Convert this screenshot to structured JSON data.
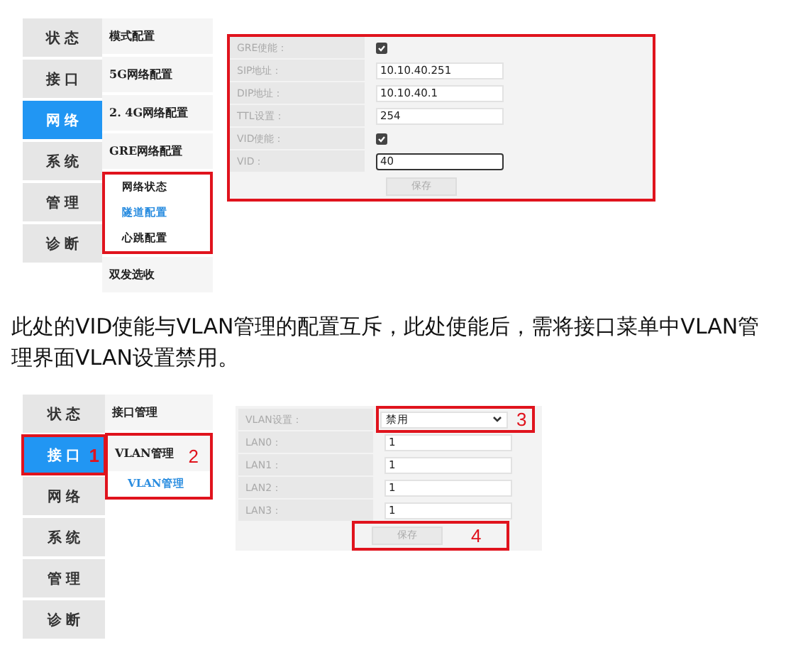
{
  "screens": [
    {
      "nav": [
        {
          "label": "状 态",
          "selected": false,
          "highlighted": false
        },
        {
          "label": "接 口",
          "selected": false,
          "highlighted": false
        },
        {
          "label": "网 络",
          "selected": true,
          "highlighted": false
        },
        {
          "label": "系 统",
          "selected": false,
          "highlighted": false
        },
        {
          "label": "管 理",
          "selected": false,
          "highlighted": false
        },
        {
          "label": "诊 断",
          "selected": false,
          "highlighted": false
        }
      ],
      "menu": [
        {
          "label": "模式配置",
          "highlighted": false
        },
        {
          "label": "5G网络配置",
          "highlighted": false
        },
        {
          "label": "2. 4G网络配置",
          "highlighted": false
        },
        {
          "label": "GRE网络配置",
          "highlighted": true,
          "frame_includes_item": false,
          "children": [
            {
              "label": "网络状态",
              "selected": false
            },
            {
              "label": "隧道配置",
              "selected": true
            },
            {
              "label": "心跳配置",
              "selected": false
            }
          ]
        },
        {
          "label": "双发选收",
          "highlighted": false
        }
      ],
      "form": {
        "highlighted": true,
        "rows": [
          {
            "label": "GRE使能：",
            "kind": "checkbox",
            "checked": true,
            "highlighted": false
          },
          {
            "label": "SIP地址：",
            "kind": "input",
            "value": "10.10.40.251",
            "focused": false,
            "highlighted": false
          },
          {
            "label": "DIP地址：",
            "kind": "input",
            "value": "10.10.40.1",
            "focused": false,
            "highlighted": false
          },
          {
            "label": "TTL设置：",
            "kind": "input",
            "value": "254",
            "focused": false,
            "highlighted": false
          },
          {
            "label": "VID使能：",
            "kind": "checkbox",
            "checked": true,
            "highlighted": false
          },
          {
            "label": "VID：",
            "kind": "input",
            "value": "40",
            "focused": true,
            "highlighted": false
          }
        ],
        "save_button": {
          "label": "保存",
          "highlighted": false
        }
      }
    },
    {
      "nav": [
        {
          "label": "状 态",
          "selected": false,
          "highlighted": false
        },
        {
          "label": "接 口",
          "selected": true,
          "highlighted": true,
          "marker": "1"
        },
        {
          "label": "网 络",
          "selected": false,
          "highlighted": false
        },
        {
          "label": "系 统",
          "selected": false,
          "highlighted": false
        },
        {
          "label": "管 理",
          "selected": false,
          "highlighted": false
        },
        {
          "label": "诊 断",
          "selected": false,
          "highlighted": false
        }
      ],
      "menu": [
        {
          "label": "接口管理",
          "highlighted": false
        },
        {
          "label": "VLAN管理",
          "highlighted": true,
          "frame_includes_item": true,
          "marker": "2",
          "children": [
            {
              "label": "VLAN管理",
              "selected": true
            }
          ]
        }
      ],
      "form": {
        "highlighted": false,
        "rows": [
          {
            "label": "VLAN设置：",
            "kind": "select",
            "value": "禁用",
            "highlighted": true,
            "marker": "3"
          },
          {
            "label": "LAN0：",
            "kind": "input",
            "value": "1",
            "focused": false,
            "highlighted": false
          },
          {
            "label": "LAN1：",
            "kind": "input",
            "value": "1",
            "focused": false,
            "highlighted": false
          },
          {
            "label": "LAN2：",
            "kind": "input",
            "value": "1",
            "focused": false,
            "highlighted": false
          },
          {
            "label": "LAN3：",
            "kind": "input",
            "value": "1",
            "focused": false,
            "highlighted": false
          }
        ],
        "save_button": {
          "label": "保存",
          "highlighted": true,
          "marker": "4"
        }
      }
    }
  ],
  "note": "此处的VID使能与VLAN管理的配置互斥，此处使能后，需将接口菜单中VLAN管理界面VLAN设置禁用。"
}
